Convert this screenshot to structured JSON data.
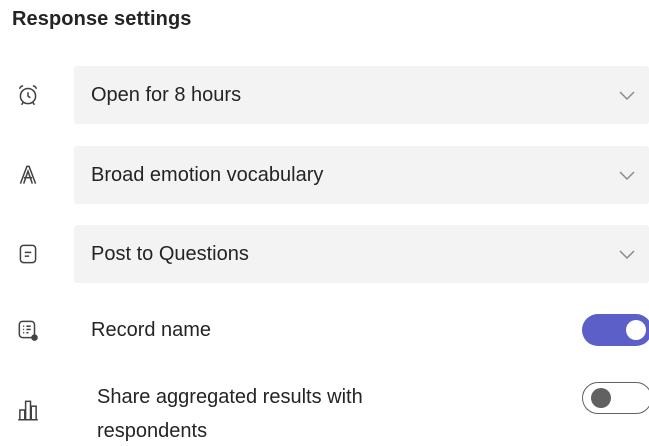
{
  "section": {
    "title": "Response settings"
  },
  "settings": [
    {
      "kind": "dropdown",
      "icon": "alarm-clock-icon",
      "label": "Open for 8 hours"
    },
    {
      "kind": "dropdown",
      "icon": "font-letter-a-icon",
      "label": "Broad emotion vocabulary"
    },
    {
      "kind": "dropdown",
      "icon": "post-note-icon",
      "label": "Post to Questions"
    },
    {
      "kind": "toggle",
      "icon": "record-list-icon",
      "label": "Record name",
      "checked": true
    },
    {
      "kind": "toggle",
      "icon": "bar-chart-icon",
      "label_line1": "Share aggregated results with",
      "label_line2": "respondents",
      "checked": false
    }
  ],
  "colors": {
    "accent": "#5b5fc7",
    "dropdown_bg": "#f3f3f3",
    "text": "#242424",
    "icon": "#424242"
  }
}
